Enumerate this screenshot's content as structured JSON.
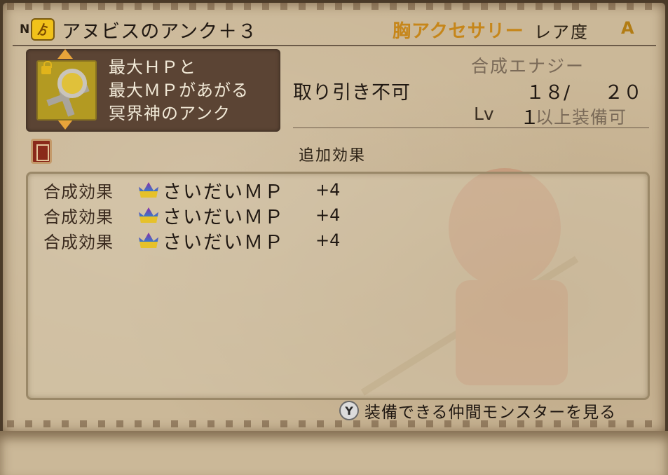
{
  "header": {
    "grade_mark": "N",
    "category_icon": "neck-accessory-icon",
    "item_name": "アヌビスのアンク＋３",
    "slot": "胸アクセサリー",
    "rarity_label": "レア度",
    "rarity_value": "A"
  },
  "description": {
    "icon": "ankh-icon",
    "locked": true,
    "lines": [
      "最大ＨＰと",
      "最大ＭＰがあがる",
      "冥界神のアンク"
    ]
  },
  "trade": "取り引き不可",
  "synthesis": {
    "label": "合成エナジー",
    "current": "１８/",
    "max": "２０"
  },
  "level": {
    "label": "Lv",
    "value": "１",
    "suffix": "以上装備可"
  },
  "extra_effects": {
    "title": "追加効果",
    "rows": [
      {
        "label": "合成効果",
        "icon": "crown-icon",
        "name": "さいだいＭＰ",
        "value": "+4"
      },
      {
        "label": "合成効果",
        "icon": "crown-icon",
        "name": "さいだいＭＰ",
        "value": "+4"
      },
      {
        "label": "合成効果",
        "icon": "crown-icon",
        "name": "さいだいＭＰ",
        "value": "+4"
      }
    ]
  },
  "footer": {
    "button": "Y",
    "text": "装備できる仲間モンスターを見る"
  },
  "colors": {
    "parchment": "#cbb898",
    "slot_text": "#c6861a",
    "rarity_value": "#b27c14",
    "desc_panel": "#5b4434"
  }
}
